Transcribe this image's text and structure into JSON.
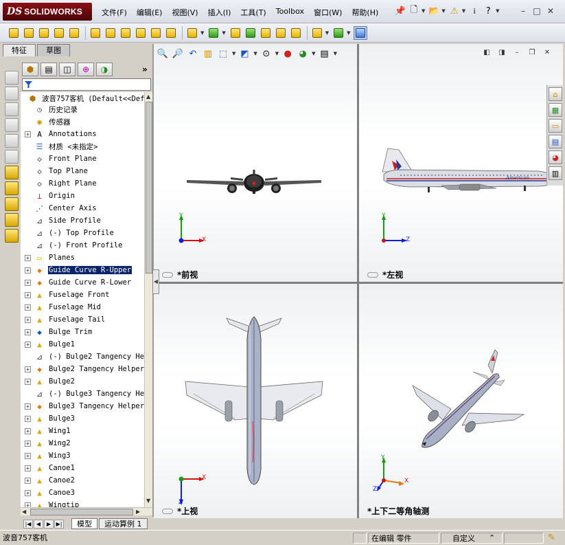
{
  "app": {
    "logo_mark": "DS",
    "logo_name": "SOLIDWORKS"
  },
  "menu": [
    "文件(F)",
    "编辑(E)",
    "视图(V)",
    "插入(I)",
    "工具(T)",
    "Toolbox",
    "窗口(W)",
    "帮助(H)"
  ],
  "menu_icons": [
    "pin-icon",
    "new-document-icon",
    "open-icon",
    "warning-icon",
    "info-icon",
    "help-icon"
  ],
  "window_buttons": {
    "min": "–",
    "restore": "□",
    "close": "✕"
  },
  "tabs": {
    "features": "特征",
    "sketch": "草图"
  },
  "tree": {
    "root": "波音757客机  (Default<<Def",
    "items": [
      {
        "label": "历史记录",
        "expand": false,
        "icon": "history-icon"
      },
      {
        "label": "传感器",
        "expand": false,
        "icon": "sensor-icon"
      },
      {
        "label": "Annotations",
        "expand": true,
        "icon": "annotations-icon"
      },
      {
        "label": "材质 <未指定>",
        "expand": false,
        "icon": "material-icon"
      },
      {
        "label": "Front Plane",
        "expand": false,
        "icon": "plane-icon"
      },
      {
        "label": "Top Plane",
        "expand": false,
        "icon": "plane-icon"
      },
      {
        "label": "Right Plane",
        "expand": false,
        "icon": "plane-icon"
      },
      {
        "label": "Origin",
        "expand": false,
        "icon": "origin-icon"
      },
      {
        "label": "Center Axis",
        "expand": false,
        "icon": "axis-icon"
      },
      {
        "label": "Side Profile",
        "expand": false,
        "icon": "sketch-icon"
      },
      {
        "label": "(-) Top Profile",
        "expand": false,
        "icon": "sketch-icon"
      },
      {
        "label": "(-) Front Profile",
        "expand": false,
        "icon": "sketch-icon"
      },
      {
        "label": "Planes",
        "expand": true,
        "icon": "folder-icon"
      },
      {
        "label": "Guide Curve R-Upper",
        "expand": true,
        "icon": "curve-icon",
        "selected": true
      },
      {
        "label": "Guide Curve R-Lower",
        "expand": true,
        "icon": "curve-icon"
      },
      {
        "label": "Fuselage Front",
        "expand": true,
        "icon": "loft-icon"
      },
      {
        "label": "Fuselage Mid",
        "expand": true,
        "icon": "loft-icon"
      },
      {
        "label": "Fuselage Tail",
        "expand": true,
        "icon": "loft-icon"
      },
      {
        "label": "Bulge Trim",
        "expand": true,
        "icon": "trim-icon"
      },
      {
        "label": "Bulge1",
        "expand": true,
        "icon": "loft-icon"
      },
      {
        "label": "(-) Bulge2 Tangency Hel",
        "expand": false,
        "icon": "sketch-icon"
      },
      {
        "label": "Bulge2 Tangency Helper",
        "expand": true,
        "icon": "curve-icon"
      },
      {
        "label": "Bulge2",
        "expand": true,
        "icon": "loft-icon"
      },
      {
        "label": "(-) Bulge3 Tangency Hel",
        "expand": false,
        "icon": "sketch-icon"
      },
      {
        "label": "Bulge3 Tangency Helper",
        "expand": true,
        "icon": "curve-icon"
      },
      {
        "label": "Bulge3",
        "expand": true,
        "icon": "loft-icon"
      },
      {
        "label": "Wing1",
        "expand": true,
        "icon": "loft-icon"
      },
      {
        "label": "Wing2",
        "expand": true,
        "icon": "loft-icon"
      },
      {
        "label": "Wing3",
        "expand": true,
        "icon": "loft-icon"
      },
      {
        "label": "Canoe1",
        "expand": true,
        "icon": "loft-icon"
      },
      {
        "label": "Canoe2",
        "expand": true,
        "icon": "loft-icon"
      },
      {
        "label": "Canoe3",
        "expand": true,
        "icon": "loft-icon"
      },
      {
        "label": "Wingtip",
        "expand": true,
        "icon": "loft-icon"
      }
    ]
  },
  "bottom_tabs": [
    "模型",
    "运动算例 1"
  ],
  "views": {
    "front": "*前视",
    "left": "*左视",
    "top": "*上视",
    "iso": "*上下二等角轴测"
  },
  "triad": {
    "x": "X",
    "y": "Y",
    "z": "Z"
  },
  "livery_text": "American",
  "status": {
    "doc_name": "波音757客机",
    "editing": "在编辑 零件",
    "units": "自定义",
    "units_arrow": "⌃"
  },
  "colors": {
    "accent": "#8a0f16",
    "selection": "#0a246a",
    "axis_x": "#d01010",
    "axis_y": "#10a010",
    "axis_z": "#1020d0"
  }
}
